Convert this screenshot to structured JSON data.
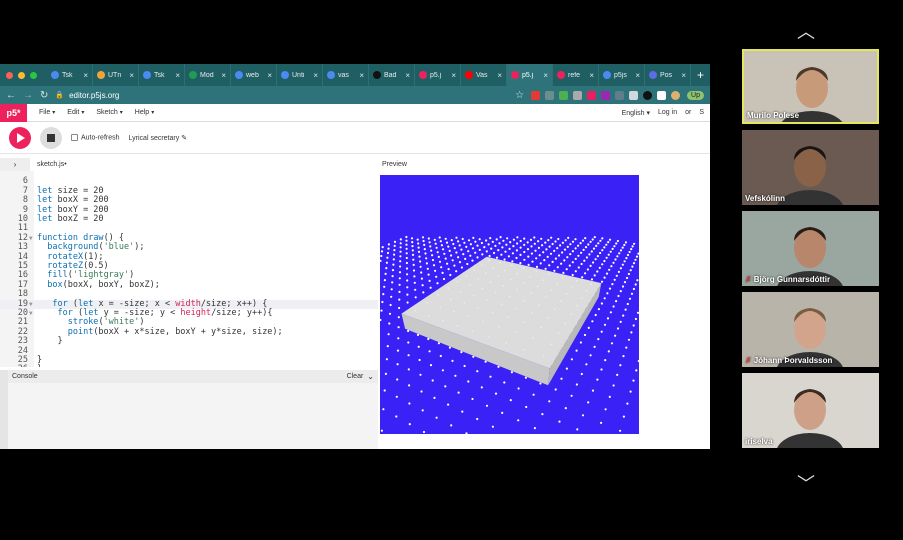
{
  "browser": {
    "tabs": [
      {
        "label": "Tsk",
        "icon": "google-icon",
        "color": "#4a8af4"
      },
      {
        "label": "UTn",
        "icon": "doc-icon",
        "color": "#f2a33a"
      },
      {
        "label": "Tsk",
        "icon": "google-icon",
        "color": "#4a8af4"
      },
      {
        "label": "Mod",
        "icon": "sheets-icon",
        "color": "#1f9d55"
      },
      {
        "label": "web",
        "icon": "google-icon",
        "color": "#4a8af4"
      },
      {
        "label": "Unti",
        "icon": "docs-icon",
        "color": "#4a8af4"
      },
      {
        "label": "vas",
        "icon": "google-icon",
        "color": "#4a8af4"
      },
      {
        "label": "Bad",
        "icon": "github-icon",
        "color": "#111111"
      },
      {
        "label": "p5.j",
        "icon": "p5-star-icon",
        "color": "#ed225d"
      },
      {
        "label": "Vas",
        "icon": "youtube-icon",
        "color": "#ff0000"
      },
      {
        "label": "p5.j",
        "icon": "p5-star-icon",
        "color": "#ed225d",
        "active": true
      },
      {
        "label": "refe",
        "icon": "p5-star-icon",
        "color": "#ed225d"
      },
      {
        "label": "p5js",
        "icon": "google-icon",
        "color": "#4a8af4"
      },
      {
        "label": "Pos",
        "icon": "chat-icon",
        "color": "#5b6ee1"
      }
    ],
    "url": "editor.p5js.org",
    "update_label": "Up"
  },
  "menubar": {
    "logo": "p5*",
    "items": [
      "File",
      "Edit",
      "Sketch",
      "Help"
    ],
    "language": "English",
    "login": "Log in",
    "or": "or",
    "signup": "S"
  },
  "toolbar": {
    "auto_refresh": "Auto-refresh",
    "sketch_name": "Lyrical secretary"
  },
  "editor": {
    "filename": "sketch.js",
    "modified_marker": "•",
    "preview_label": "Preview",
    "lines": [
      {
        "n": "",
        "html": ""
      },
      {
        "n": "6",
        "html": ""
      },
      {
        "n": "7",
        "html": "<span class='kw'>let</span> size = 20"
      },
      {
        "n": "8",
        "html": "<span class='kw'>let</span> boxX = 200"
      },
      {
        "n": "9",
        "html": "<span class='kw'>let</span> boxY = 200"
      },
      {
        "n": "10",
        "html": "<span class='kw'>let</span> boxZ = 20"
      },
      {
        "n": "11",
        "html": ""
      },
      {
        "n": "12",
        "fold": true,
        "html": "<span class='kw'>function</span> <span class='fn'>draw</span>() {"
      },
      {
        "n": "13",
        "html": "  <span class='fn'>background</span>(<span class='str'>'blue'</span>);"
      },
      {
        "n": "14",
        "html": "  <span class='fn'>rotateX</span>(1);"
      },
      {
        "n": "15",
        "html": "  <span class='fn'>rotateZ</span>(0.5)"
      },
      {
        "n": "16",
        "html": "  <span class='fn'>fill</span>(<span class='str'>'lightgray'</span>)"
      },
      {
        "n": "17",
        "html": "  <span class='fn'>box</span>(boxX, boxY, boxZ);"
      },
      {
        "n": "18",
        "html": ""
      },
      {
        "n": "19",
        "fold": true,
        "hl": true,
        "html": "   <span class='kw'>for</span> (<span class='kw'>let</span> x = -size; x &lt; <span class='pk'>width</span>/size; x++) {"
      },
      {
        "n": "20",
        "fold": true,
        "html": "    <span class='kw'>for</span> (<span class='kw'>let</span> y = -size; y &lt; <span class='pk'>height</span>/size; y++){"
      },
      {
        "n": "21",
        "html": "      <span class='fn'>stroke</span>(<span class='str'>'white'</span>)"
      },
      {
        "n": "22",
        "html": "      <span class='fn'>point</span>(boxX + x*size, boxY + y*size, size);"
      },
      {
        "n": "23",
        "html": "    }"
      },
      {
        "n": "24",
        "html": ""
      },
      {
        "n": "25",
        "html": "}"
      },
      {
        "n": "26",
        "html": "}"
      }
    ]
  },
  "console": {
    "label": "Console",
    "clear": "Clear"
  },
  "participants": [
    {
      "name": "Murilo Polese",
      "active": true,
      "muted": false,
      "bg": "#c9c2b6",
      "face": "#c79a7a",
      "hair": "#4b3a2c"
    },
    {
      "name": "Vefskólinn",
      "active": false,
      "muted": false,
      "bg": "#6a5a52",
      "face": "#8a6248",
      "hair": "#1a1512"
    },
    {
      "name": "Björg Gunnarsdóttir",
      "active": false,
      "muted": true,
      "bg": "#9aa7a0",
      "face": "#b7866b",
      "hair": "#2a1c15"
    },
    {
      "name": "Jóhann Þorvaldsson",
      "active": false,
      "muted": true,
      "bg": "#b9b4aa",
      "face": "#d2a48b",
      "hair": "#7a5c40"
    },
    {
      "name": "iriselva",
      "active": false,
      "muted": false,
      "bg": "#d9d6cf",
      "face": "#cfa088",
      "hair": "#3a2a20"
    }
  ],
  "colors": {
    "p5_pink": "#ed225d",
    "canvas_blue": "#3a21f5",
    "tabbar": "#1f5f63"
  }
}
